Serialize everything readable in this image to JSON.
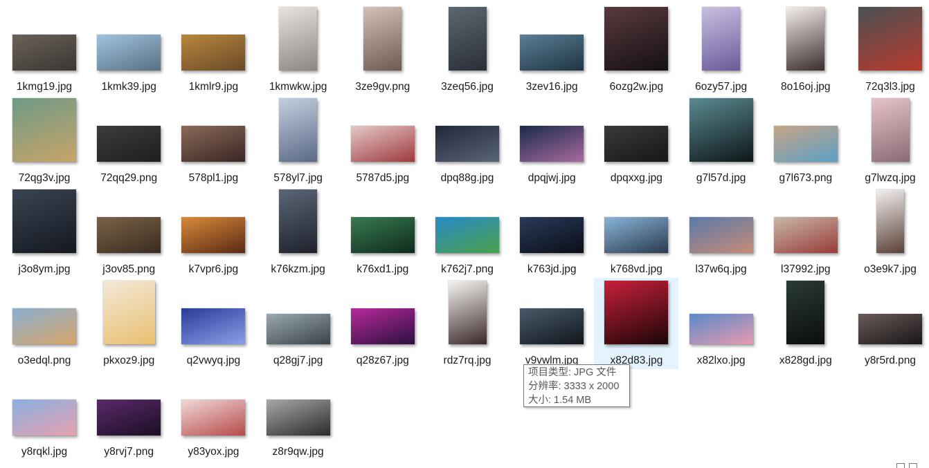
{
  "files": [
    {
      "name": "1kmg19.jpg",
      "thumb": "landscape",
      "colors": [
        "#6b6259",
        "#3a3632"
      ]
    },
    {
      "name": "1kmk39.jpg",
      "thumb": "landscape",
      "colors": [
        "#9fc4e0",
        "#5a6f82"
      ]
    },
    {
      "name": "1kmlr9.jpg",
      "thumb": "landscape",
      "colors": [
        "#b8873c",
        "#6a4a2a"
      ]
    },
    {
      "name": "1kmwkw.jpg",
      "thumb": "portrait",
      "colors": [
        "#e8e3df",
        "#8d8682"
      ]
    },
    {
      "name": "3ze9gv.png",
      "thumb": "portrait",
      "colors": [
        "#d4c2b6",
        "#6e5a50"
      ]
    },
    {
      "name": "3zeq56.jpg",
      "thumb": "portrait",
      "colors": [
        "#5e6670",
        "#2a2f36"
      ]
    },
    {
      "name": "3zev16.jpg",
      "thumb": "landscape",
      "colors": [
        "#5a7f95",
        "#1f3442"
      ]
    },
    {
      "name": "6ozg2w.jpg",
      "thumb": "square",
      "colors": [
        "#5a3a3e",
        "#141012"
      ]
    },
    {
      "name": "6ozy57.jpg",
      "thumb": "portrait",
      "colors": [
        "#c9c0e0",
        "#6a5a9a"
      ]
    },
    {
      "name": "8o16oj.jpg",
      "thumb": "portrait",
      "colors": [
        "#f4eeea",
        "#3a2e2c"
      ]
    },
    {
      "name": "72q3l3.jpg",
      "thumb": "landscape-tall",
      "colors": [
        "#4a5052",
        "#b83a2e"
      ]
    },
    {
      "name": "72qg3v.jpg",
      "thumb": "square",
      "colors": [
        "#6e9a86",
        "#c8a468"
      ]
    },
    {
      "name": "72qq29.png",
      "thumb": "landscape",
      "colors": [
        "#3a3c3e",
        "#1c1e20"
      ]
    },
    {
      "name": "578pl1.jpg",
      "thumb": "landscape",
      "colors": [
        "#8a6a58",
        "#3a2624"
      ]
    },
    {
      "name": "578yl7.jpg",
      "thumb": "portrait",
      "colors": [
        "#c4cfe0",
        "#5a6a86"
      ]
    },
    {
      "name": "5787d5.jpg",
      "thumb": "landscape",
      "colors": [
        "#e6c8c8",
        "#9e3a3e"
      ]
    },
    {
      "name": "dpq88g.jpg",
      "thumb": "landscape",
      "colors": [
        "#202838",
        "#5a6478"
      ]
    },
    {
      "name": "dpqjwj.jpg",
      "thumb": "landscape",
      "colors": [
        "#1a2a4a",
        "#a86aa0"
      ]
    },
    {
      "name": "dpqxxg.jpg",
      "thumb": "landscape",
      "colors": [
        "#3a3a3c",
        "#161618"
      ]
    },
    {
      "name": "g7l57d.jpg",
      "thumb": "landscape-tall",
      "colors": [
        "#5a8a92",
        "#0e1618"
      ]
    },
    {
      "name": "g7l673.png",
      "thumb": "landscape",
      "colors": [
        "#c8a484",
        "#5aa0c8"
      ]
    },
    {
      "name": "g7lwzq.jpg",
      "thumb": "portrait",
      "colors": [
        "#e6c4c8",
        "#8a6a74"
      ]
    },
    {
      "name": "j3o8ym.jpg",
      "thumb": "square",
      "colors": [
        "#3a4452",
        "#141820"
      ]
    },
    {
      "name": "j3ov85.png",
      "thumb": "landscape",
      "colors": [
        "#7a6248",
        "#3a2c20"
      ]
    },
    {
      "name": "k7vpr6.jpg",
      "thumb": "landscape",
      "colors": [
        "#d88a3a",
        "#5a2a14"
      ]
    },
    {
      "name": "k76kzm.jpg",
      "thumb": "portrait",
      "colors": [
        "#5a6678",
        "#1e222a"
      ]
    },
    {
      "name": "k76xd1.jpg",
      "thumb": "landscape",
      "colors": [
        "#3a7a52",
        "#0e2a1c"
      ]
    },
    {
      "name": "k762j7.png",
      "thumb": "landscape",
      "colors": [
        "#2a8ac8",
        "#4aa048"
      ]
    },
    {
      "name": "k763jd.jpg",
      "thumb": "landscape",
      "colors": [
        "#2a3a5a",
        "#0a0e16"
      ]
    },
    {
      "name": "k768vd.jpg",
      "thumb": "landscape",
      "colors": [
        "#8ab4d8",
        "#2a3a4e"
      ]
    },
    {
      "name": "l37w6q.jpg",
      "thumb": "landscape",
      "colors": [
        "#5a7aa8",
        "#c88a78"
      ]
    },
    {
      "name": "l37992.jpg",
      "thumb": "landscape",
      "colors": [
        "#c8b8a8",
        "#9a3a3a"
      ]
    },
    {
      "name": "o3e9k7.jpg",
      "thumb": "portrait-narrow",
      "colors": [
        "#f4f0ee",
        "#5a4038"
      ]
    },
    {
      "name": "o3edql.png",
      "thumb": "landscape",
      "colors": [
        "#8ab0d0",
        "#d8a468"
      ]
    },
    {
      "name": "pkxoz9.jpg",
      "thumb": "portrait-wide",
      "colors": [
        "#f4e8d8",
        "#e8c070"
      ]
    },
    {
      "name": "q2vwyq.jpg",
      "thumb": "landscape",
      "colors": [
        "#2a3a9a",
        "#8aa0e8"
      ]
    },
    {
      "name": "q28gj7.jpg",
      "thumb": "landscape-short",
      "colors": [
        "#9aa8b0",
        "#3a4248"
      ]
    },
    {
      "name": "q28z67.jpg",
      "thumb": "landscape",
      "colors": [
        "#b82a9a",
        "#2a1040"
      ]
    },
    {
      "name": "rdz7rq.jpg",
      "thumb": "portrait",
      "colors": [
        "#f6f4f2",
        "#3a2a28"
      ]
    },
    {
      "name": "v9vwlm.jpg",
      "thumb": "landscape",
      "colors": [
        "#4a5a6a",
        "#10161c"
      ]
    },
    {
      "name": "x82d83.jpg",
      "thumb": "square",
      "colors": [
        "#c8203a",
        "#1a0608"
      ]
    },
    {
      "name": "x82lxo.jpg",
      "thumb": "landscape-short",
      "colors": [
        "#5a8ac8",
        "#e89ab0"
      ]
    },
    {
      "name": "x828gd.jpg",
      "thumb": "portrait",
      "colors": [
        "#2a3a32",
        "#0a0e0c"
      ]
    },
    {
      "name": "y8r5rd.png",
      "thumb": "landscape-short",
      "colors": [
        "#6a5a5a",
        "#1a1616"
      ]
    },
    {
      "name": "y8rqkl.jpg",
      "thumb": "landscape",
      "colors": [
        "#8ab0e0",
        "#e8a0b0"
      ]
    },
    {
      "name": "y8rvj7.png",
      "thumb": "landscape",
      "colors": [
        "#5a2a6a",
        "#1a0e24"
      ]
    },
    {
      "name": "y83yox.jpg",
      "thumb": "landscape",
      "colors": [
        "#f0d8d8",
        "#b84a4a"
      ]
    },
    {
      "name": "z8r9qw.jpg",
      "thumb": "landscape",
      "colors": [
        "#a8a8a8",
        "#2a2a2a"
      ]
    }
  ],
  "hovered_index": 40,
  "tooltip": {
    "type": "项目类型: JPG 文件",
    "resolution": "分辨率: 3333 x 2000",
    "size": "大小: 1.54 MB"
  }
}
